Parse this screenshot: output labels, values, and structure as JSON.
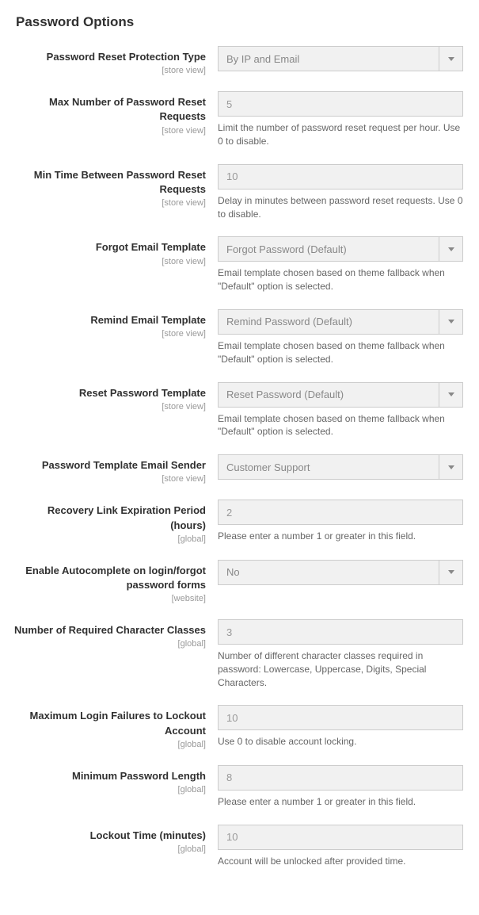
{
  "section_title": "Password Options",
  "scopes": {
    "store_view": "[store view]",
    "global": "[global]",
    "website": "[website]"
  },
  "fields": {
    "protection_type": {
      "label": "Password Reset Protection Type",
      "value": "By IP and Email"
    },
    "max_requests": {
      "label": "Max Number of Password Reset Requests",
      "value": "5",
      "note": "Limit the number of password reset request per hour. Use 0 to disable."
    },
    "min_time": {
      "label": "Min Time Between Password Reset Requests",
      "value": "10",
      "note": "Delay in minutes between password reset requests. Use 0 to disable."
    },
    "forgot_template": {
      "label": "Forgot Email Template",
      "value": "Forgot Password (Default)",
      "note": "Email template chosen based on theme fallback when \"Default\" option is selected."
    },
    "remind_template": {
      "label": "Remind Email Template",
      "value": "Remind Password (Default)",
      "note": "Email template chosen based on theme fallback when \"Default\" option is selected."
    },
    "reset_template": {
      "label": "Reset Password Template",
      "value": "Reset Password (Default)",
      "note": "Email template chosen based on theme fallback when \"Default\" option is selected."
    },
    "email_sender": {
      "label": "Password Template Email Sender",
      "value": "Customer Support"
    },
    "recovery_expiration": {
      "label": "Recovery Link Expiration Period (hours)",
      "value": "2",
      "note": "Please enter a number 1 or greater in this field."
    },
    "autocomplete": {
      "label": "Enable Autocomplete on login/forgot password forms",
      "value": "No"
    },
    "char_classes": {
      "label": "Number of Required Character Classes",
      "value": "3",
      "note": "Number of different character classes required in password: Lowercase, Uppercase, Digits, Special Characters."
    },
    "max_failures": {
      "label": "Maximum Login Failures to Lockout Account",
      "value": "10",
      "note": "Use 0 to disable account locking."
    },
    "min_length": {
      "label": "Minimum Password Length",
      "value": "8",
      "note": "Please enter a number 1 or greater in this field."
    },
    "lockout_time": {
      "label": "Lockout Time (minutes)",
      "value": "10",
      "note": "Account will be unlocked after provided time."
    }
  }
}
